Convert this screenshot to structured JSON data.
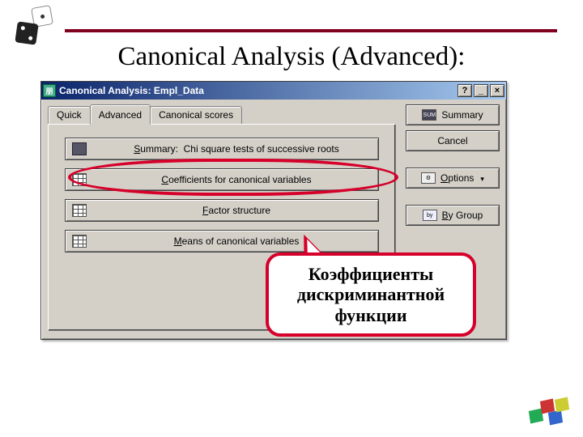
{
  "slide": {
    "title": "Canonical Analysis (Advanced):"
  },
  "dialog": {
    "title": "Canonical Analysis: Empl_Data",
    "sysbuttons": {
      "help": "?",
      "min": "_",
      "close": "×"
    },
    "tabs": {
      "quick": "Quick",
      "advanced": "Advanced",
      "scores": "Canonical scores"
    },
    "buttons": {
      "summary_chi": "Summary:  Chi square tests of successive roots",
      "summary_chi_u": "S",
      "coeffs": "Coefficients for canonical variables",
      "coeffs_u": "C",
      "factor": "Factor structure",
      "factor_u": "F",
      "means": "Means of canonical variables",
      "means_u": "M"
    },
    "right": {
      "summary": "Summary",
      "cancel": "Cancel",
      "options": "Options",
      "options_u": "O",
      "bygroup": "By Group",
      "bygroup_u": "B"
    }
  },
  "callout": {
    "line1": "Коэффициенты",
    "line2": "дискриминантной",
    "line3": "функции"
  }
}
